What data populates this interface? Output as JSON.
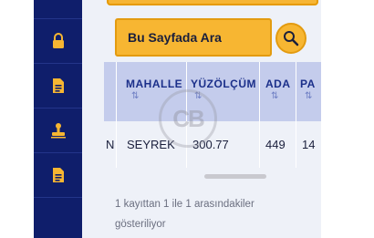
{
  "sidebar": {
    "items": [
      {
        "icon": "lock-icon"
      },
      {
        "icon": "document-icon"
      },
      {
        "icon": "stamp-icon"
      },
      {
        "icon": "document-icon"
      }
    ]
  },
  "search": {
    "button_label": "Bu Sayfada Ara",
    "icon": "search-icon"
  },
  "table": {
    "columns": [
      "MAHALLE",
      "YÜZÖLÇÜM",
      "ADA",
      "PA"
    ],
    "sort_glyph": "⇅",
    "rows": [
      {
        "prev_cut": "N",
        "mahalle": "SEYREK",
        "yuzolcum": "300.77",
        "ada": "449",
        "parsel_cut": "14"
      }
    ]
  },
  "footer": {
    "info_line1": "1 kayıttan 1 ile 1 arasındakiler",
    "info_line2": "gösteriliyor"
  },
  "watermark": {
    "logo_text": "CB"
  },
  "colors": {
    "sidebar": "#0f1e6b",
    "accent_orange": "#f7b632",
    "table_header": "#c4ccec",
    "header_text": "#1b2f8a"
  }
}
